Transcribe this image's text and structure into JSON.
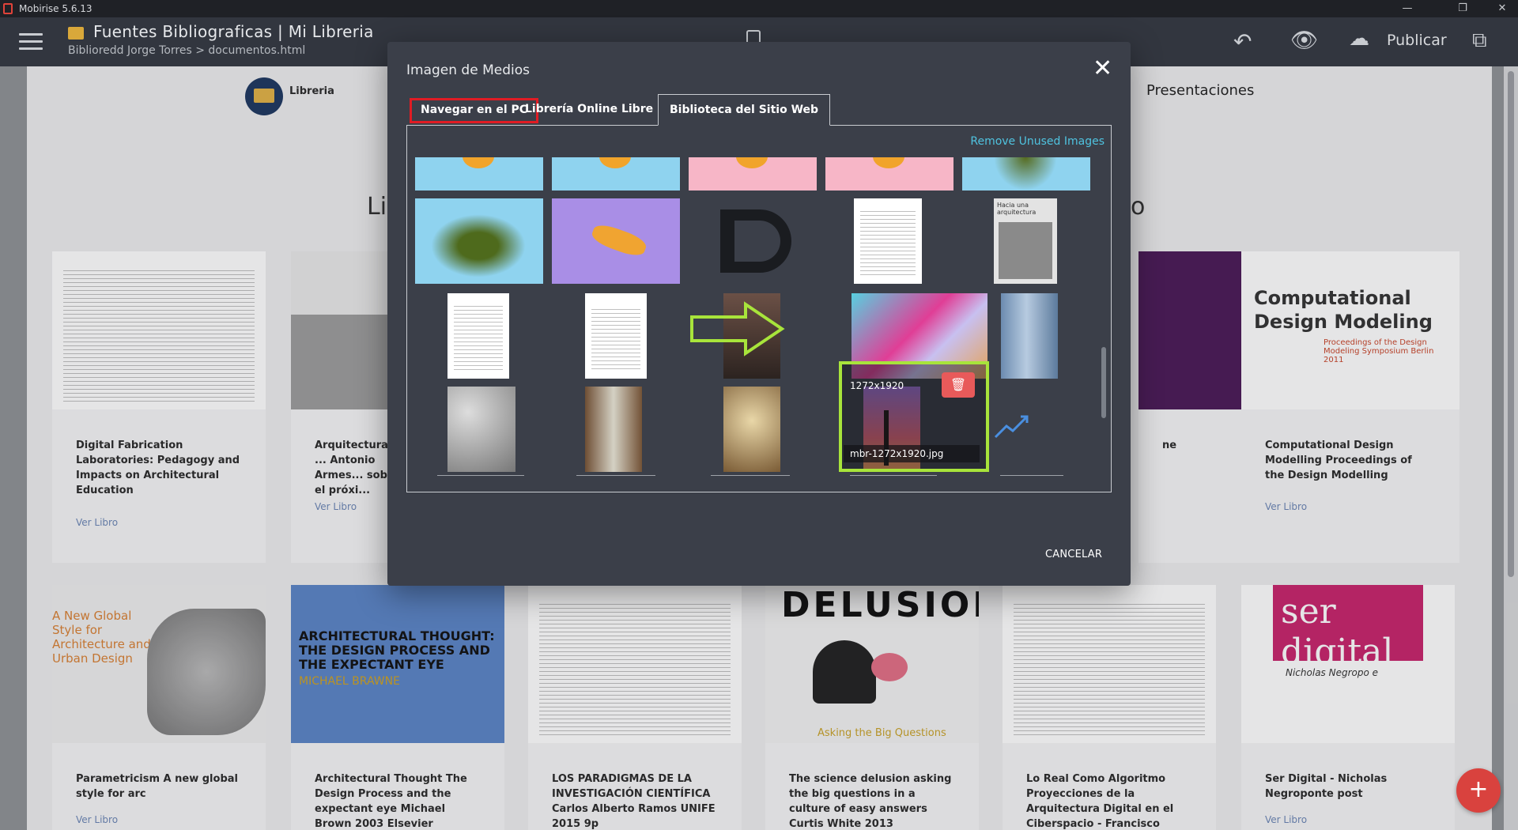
{
  "window": {
    "title": "Mobirise 5.6.13",
    "controls": [
      "—",
      "❐",
      "✕"
    ]
  },
  "header": {
    "project_title": "Fuentes Bibliograficas | Mi Libreria",
    "breadcrumb": "Biblioredd Jorge Torres > documentos.html",
    "publish_label": "Publicar",
    "icons": [
      "hamburger-icon",
      "device-icon",
      "undo-icon",
      "eye-icon",
      "cloud-upload-icon",
      "blocks-icon"
    ]
  },
  "page": {
    "logo_text": "Libreria",
    "nav_right": "Presentaciones",
    "side_left": "Li",
    "side_right": "o",
    "row1": [
      {
        "title": "Digital Fabrication Laboratories: Pedagogy and Impacts on Architectural Education",
        "link": "Ver Libro"
      },
      {
        "title": "Arquitectura y ... Antonio Armes... sobre el próxi...",
        "link": "Ver Libro"
      },
      {
        "title": "Computational Design Modelling Proceedings of the Design Modelling",
        "link": "Ver Libro"
      }
    ],
    "row1_partial_title": "ne",
    "row2": [
      {
        "title": "Parametricism A new global style for arc",
        "link": "Ver Libro",
        "cover_text": "A New Global Style for Architecture and Urban Design"
      },
      {
        "title": "Architectural Thought The Design Process and the expectant eye Michael Brown 2003 Elsevier",
        "link": "",
        "cover_text": "ARCHITECTURAL THOUGHT: THE DESIGN PROCESS AND THE EXPECTANT EYE",
        "cover_author": "MICHAEL BRAWNE"
      },
      {
        "title": "LOS PARADIGMAS DE LA INVESTIGACIÓN CIENTÍFICA Carlos Alberto Ramos UNIFE 2015 9p",
        "link": ""
      },
      {
        "title": "The science delusion asking the big questions in a culture of easy answers Curtis White 2013",
        "link": "",
        "cover_text": "DELUSION",
        "cover_sub": "Asking the Big Questions"
      },
      {
        "title": "Lo Real Como Algoritmo Proyecciones de la Arquitectura Digital en el Ciberspacio - Francisco Magín Fernández",
        "link": ""
      },
      {
        "title": "Ser Digital - Nicholas Negroponte post",
        "link": "Ver Libro",
        "cover_text": "ser digital",
        "cover_author": "Nicholas Negropo e"
      }
    ],
    "cover_cdm": {
      "title": "Computational Design Modeling",
      "sub": "Proceedings of the Design Modeling Symposium Berlin 2011"
    }
  },
  "modal": {
    "title": "Imagen de Medios",
    "close": "✕",
    "tabs": [
      {
        "label": "Navegar en el PC",
        "highlighted": true
      },
      {
        "label": "Librería Online Libre"
      },
      {
        "label": "Biblioteca del Sitio Web",
        "active": true
      }
    ],
    "remove_unused": "Remove Unused Images",
    "selected_image": {
      "size": "1272x1920",
      "filename": "mbr-1272x1920.jpg"
    },
    "thumb_texts": {
      "archi_doc": "Hacia una arquitectura"
    },
    "cancel": "CANCELAR"
  },
  "fab": "+",
  "colors": {
    "accent_red": "#e01c24",
    "highlight_green": "#a8e43b",
    "link_blue": "#4fc3e0",
    "modal_bg": "#3b3f49"
  }
}
